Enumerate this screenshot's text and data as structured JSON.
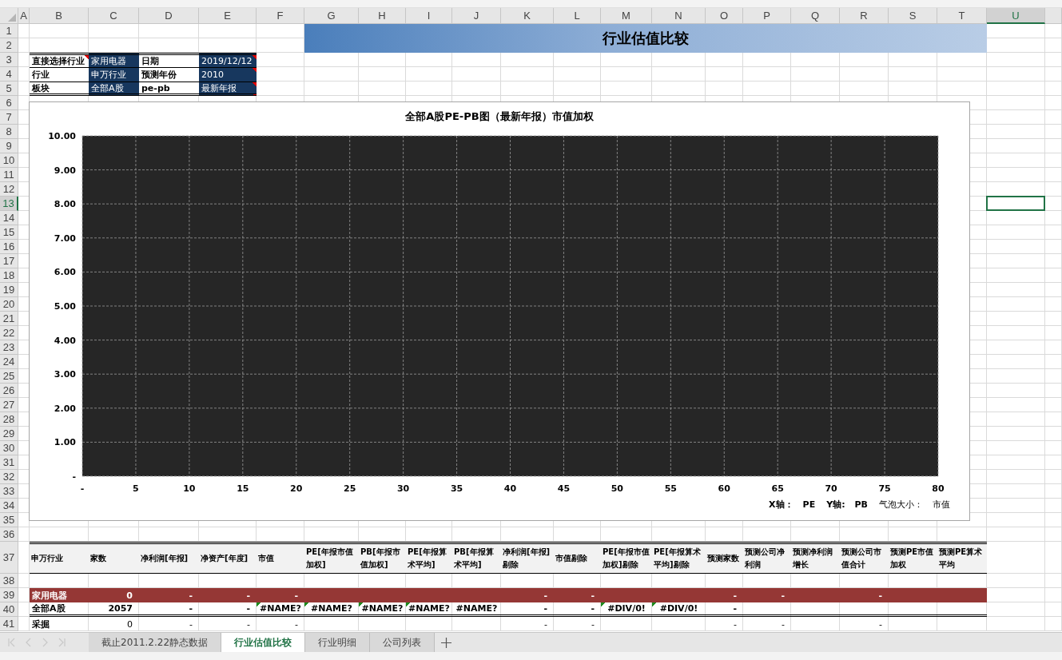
{
  "column_headers": [
    {
      "label": "A",
      "selected": false
    },
    {
      "label": "B",
      "selected": false
    },
    {
      "label": "C",
      "selected": false
    },
    {
      "label": "D",
      "selected": false
    },
    {
      "label": "E",
      "selected": false
    },
    {
      "label": "F",
      "selected": false
    },
    {
      "label": "G",
      "selected": false
    },
    {
      "label": "H",
      "selected": false
    },
    {
      "label": "I",
      "selected": false
    },
    {
      "label": "J",
      "selected": false
    },
    {
      "label": "K",
      "selected": false
    },
    {
      "label": "L",
      "selected": false
    },
    {
      "label": "M",
      "selected": false
    },
    {
      "label": "N",
      "selected": false
    },
    {
      "label": "O",
      "selected": false
    },
    {
      "label": "P",
      "selected": false
    },
    {
      "label": "Q",
      "selected": false
    },
    {
      "label": "R",
      "selected": false
    },
    {
      "label": "S",
      "selected": false
    },
    {
      "label": "T",
      "selected": false
    },
    {
      "label": "U",
      "selected": true
    }
  ],
  "row_headers": [
    {
      "label": "1",
      "selected": false
    },
    {
      "label": "2",
      "selected": false
    },
    {
      "label": "3",
      "selected": false
    },
    {
      "label": "4",
      "selected": false
    },
    {
      "label": "5",
      "selected": false
    },
    {
      "label": "6",
      "selected": false
    },
    {
      "label": "7",
      "selected": false
    },
    {
      "label": "8",
      "selected": false
    },
    {
      "label": "9",
      "selected": false
    },
    {
      "label": "10",
      "selected": false
    },
    {
      "label": "11",
      "selected": false
    },
    {
      "label": "12",
      "selected": false
    },
    {
      "label": "13",
      "selected": true
    },
    {
      "label": "14",
      "selected": false
    },
    {
      "label": "15",
      "selected": false
    },
    {
      "label": "16",
      "selected": false
    },
    {
      "label": "17",
      "selected": false
    },
    {
      "label": "18",
      "selected": false
    },
    {
      "label": "19",
      "selected": false
    },
    {
      "label": "20",
      "selected": false
    },
    {
      "label": "21",
      "selected": false
    },
    {
      "label": "22",
      "selected": false
    },
    {
      "label": "23",
      "selected": false
    },
    {
      "label": "24",
      "selected": false
    },
    {
      "label": "25",
      "selected": false
    },
    {
      "label": "26",
      "selected": false
    },
    {
      "label": "27",
      "selected": false
    },
    {
      "label": "28",
      "selected": false
    },
    {
      "label": "29",
      "selected": false
    },
    {
      "label": "30",
      "selected": false
    },
    {
      "label": "31",
      "selected": false
    },
    {
      "label": "32",
      "selected": false
    },
    {
      "label": "33",
      "selected": false
    },
    {
      "label": "34",
      "selected": false
    },
    {
      "label": "35",
      "selected": false
    },
    {
      "label": "36",
      "selected": false
    },
    {
      "label": "37",
      "selected": false
    },
    {
      "label": "38",
      "selected": false
    },
    {
      "label": "39",
      "selected": false
    },
    {
      "label": "40",
      "selected": false
    },
    {
      "label": "41",
      "selected": false
    }
  ],
  "title_banner": "行业估值比较",
  "info_table": [
    [
      {
        "label": "直接选择行业",
        "label_comment": true,
        "value": "家用电器",
        "value_comment": false
      },
      {
        "label": "日期",
        "label_comment": false,
        "value": "2019/12/12",
        "value_comment": true
      }
    ],
    [
      {
        "label": "行业",
        "label_comment": false,
        "value": "申万行业",
        "value_comment": false
      },
      {
        "label": "预测年份",
        "label_comment": false,
        "value": "2010",
        "value_comment": true
      }
    ],
    [
      {
        "label": "板块",
        "label_comment": false,
        "value": "全部A股",
        "value_comment": false
      },
      {
        "label": "pe-pb",
        "label_comment": false,
        "value": "最新年报",
        "value_comment": true
      }
    ]
  ],
  "chart": {
    "chart_data": {
      "type": "scatter",
      "title": "全部A股PE-PB图（最新年报）市值加权",
      "grid": true,
      "xlim": [
        0,
        80
      ],
      "ylim": [
        0,
        10
      ],
      "xticks": [
        {
          "value": 0,
          "label": "-"
        },
        {
          "value": 5,
          "label": "5"
        },
        {
          "value": 10,
          "label": "10"
        },
        {
          "value": 15,
          "label": "15"
        },
        {
          "value": 20,
          "label": "20"
        },
        {
          "value": 25,
          "label": "25"
        },
        {
          "value": 30,
          "label": "30"
        },
        {
          "value": 35,
          "label": "35"
        },
        {
          "value": 40,
          "label": "40"
        },
        {
          "value": 45,
          "label": "45"
        },
        {
          "value": 50,
          "label": "50"
        },
        {
          "value": 55,
          "label": "55"
        },
        {
          "value": 60,
          "label": "60"
        },
        {
          "value": 65,
          "label": "65"
        },
        {
          "value": 70,
          "label": "70"
        },
        {
          "value": 75,
          "label": "75"
        },
        {
          "value": 80,
          "label": "80"
        }
      ],
      "yticks": [
        {
          "value": 0,
          "label": "-"
        },
        {
          "value": 1,
          "label": "1.00"
        },
        {
          "value": 2,
          "label": "2.00"
        },
        {
          "value": 3,
          "label": "3.00"
        },
        {
          "value": 4,
          "label": "4.00"
        },
        {
          "value": 5,
          "label": "5.00"
        },
        {
          "value": 6,
          "label": "6.00"
        },
        {
          "value": 7,
          "label": "7.00"
        },
        {
          "value": 8,
          "label": "8.00"
        },
        {
          "value": 9,
          "label": "9.00"
        },
        {
          "value": 10,
          "label": "10.00"
        }
      ]
    },
    "axis_notes": [
      {
        "label": "X轴：",
        "label_bold": true,
        "value": "PE",
        "value_bold": true
      },
      {
        "label": "Y轴:",
        "label_bold": true,
        "value": "PB",
        "value_bold": true
      },
      {
        "label": "气泡大小：",
        "label_bold": false,
        "value": "市值",
        "value_bold": false
      }
    ]
  },
  "table": {
    "columns": [
      "申万行业",
      "家数",
      "净利润[年报]",
      "净资产[年度]",
      "市值",
      "PE[年报市值加权]",
      "PB[年报市值加权]",
      "PE[年报算术平均]",
      "PB[年报算术平均]",
      "净利润[年报]剔除",
      "市值剔除",
      "PE[年报市值加权]剔除",
      "PE[年报算术平均]剔除",
      "预测家数",
      "预测公司净利润",
      "预测净利润增长",
      "预测公司市值合计",
      "预测PE市值加权",
      "预测PE算术平均"
    ],
    "rows": [
      {
        "kind": "industry",
        "highlighted": true,
        "cells": [
          {
            "text": "家用电器",
            "kind": "name",
            "flagged": false
          },
          {
            "text": "0",
            "kind": "value",
            "flagged": false
          },
          {
            "text": "-",
            "kind": "value",
            "flagged": false
          },
          {
            "text": "-",
            "kind": "value",
            "flagged": false
          },
          {
            "text": "-",
            "kind": "value",
            "flagged": false
          },
          null,
          null,
          null,
          null,
          {
            "text": "-",
            "kind": "value",
            "flagged": false
          },
          {
            "text": "-",
            "kind": "value",
            "flagged": false
          },
          null,
          null,
          {
            "text": "-",
            "kind": "value",
            "flagged": false
          },
          {
            "text": "-",
            "kind": "value",
            "flagged": false
          },
          null,
          {
            "text": "-",
            "kind": "value",
            "flagged": false
          },
          null,
          null
        ]
      },
      {
        "kind": "summary",
        "highlighted": false,
        "cells": [
          {
            "text": "全部A股",
            "kind": "name",
            "flagged": false
          },
          {
            "text": "2057",
            "kind": "value",
            "flagged": false
          },
          {
            "text": "-",
            "kind": "value",
            "flagged": false
          },
          {
            "text": "-",
            "kind": "value",
            "flagged": false
          },
          {
            "text": "#NAME?",
            "kind": "error",
            "flagged": true
          },
          {
            "text": "#NAME?",
            "kind": "error",
            "flagged": true
          },
          {
            "text": "#NAME?",
            "kind": "error",
            "flagged": true
          },
          {
            "text": "#NAME?",
            "kind": "error",
            "flagged": true
          },
          {
            "text": "#NAME?",
            "kind": "error",
            "flagged": false
          },
          {
            "text": "-",
            "kind": "value",
            "flagged": false
          },
          {
            "text": "-",
            "kind": "value",
            "flagged": false
          },
          {
            "text": "#DIV/0!",
            "kind": "error",
            "flagged": true
          },
          {
            "text": "#DIV/0!",
            "kind": "error",
            "flagged": true
          },
          {
            "text": "-",
            "kind": "value",
            "flagged": false
          },
          null,
          null,
          null,
          null,
          null
        ]
      },
      {
        "kind": "industry",
        "highlighted": false,
        "cells": [
          {
            "text": "采掘",
            "kind": "name",
            "flagged": false
          },
          {
            "text": "0",
            "kind": "value",
            "flagged": false
          },
          {
            "text": "-",
            "kind": "value",
            "flagged": false
          },
          {
            "text": "-",
            "kind": "value",
            "flagged": false
          },
          {
            "text": "-",
            "kind": "value",
            "flagged": false
          },
          null,
          null,
          null,
          null,
          {
            "text": "-",
            "kind": "value",
            "flagged": false
          },
          {
            "text": "-",
            "kind": "value",
            "flagged": false
          },
          null,
          null,
          {
            "text": "-",
            "kind": "value",
            "flagged": false
          },
          {
            "text": "-",
            "kind": "value",
            "flagged": false
          },
          null,
          {
            "text": "-",
            "kind": "value",
            "flagged": false
          },
          null,
          null
        ]
      }
    ]
  },
  "sheet_tabs": [
    {
      "label": "截止2011.2.22静态数据",
      "selected": false
    },
    {
      "label": "行业估值比较",
      "selected": true
    },
    {
      "label": "行业明细",
      "selected": false
    },
    {
      "label": "公司列表",
      "selected": false
    }
  ]
}
